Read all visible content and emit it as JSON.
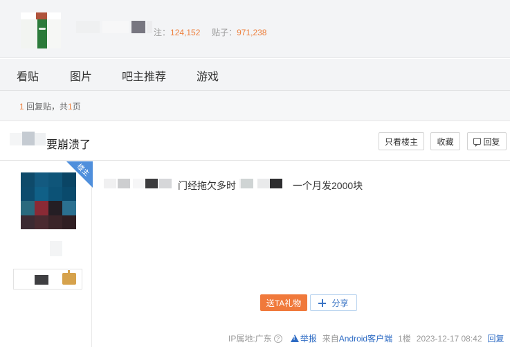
{
  "header": {
    "stats_follow_label": "注：",
    "stats_follow_value": "124,152",
    "stats_posts_label": "贴子：",
    "stats_posts_value": "971,238"
  },
  "nav": {
    "tabs": [
      {
        "label": "看贴"
      },
      {
        "label": "图片"
      },
      {
        "label": "吧主推荐"
      },
      {
        "label": "游戏"
      }
    ]
  },
  "reply_bar": {
    "count": "1",
    "middle": "回复贴，共",
    "pages": "1",
    "suffix": "页"
  },
  "thread": {
    "title_visible": "要崩溃了",
    "buttons": {
      "only_op": "只看楼主",
      "favorite": "收藏",
      "reply": "回复"
    }
  },
  "post": {
    "op_badge": "楼主",
    "content_part1": "门经拖欠多时",
    "content_part2": "一个月发2000块",
    "gift_button": "送TA礼物",
    "share_button": "分享",
    "ip_location": "IP属地:广东",
    "report": "举报",
    "source_prefix": "来自",
    "source_link": "Android客户端",
    "floor": "1楼",
    "datetime": "2023-12-17 08:42",
    "reply_link": "回复"
  },
  "colors": {
    "accent_orange": "#f0793b",
    "link_blue": "#2d6bc4",
    "badge_blue": "#4f8fdc"
  }
}
